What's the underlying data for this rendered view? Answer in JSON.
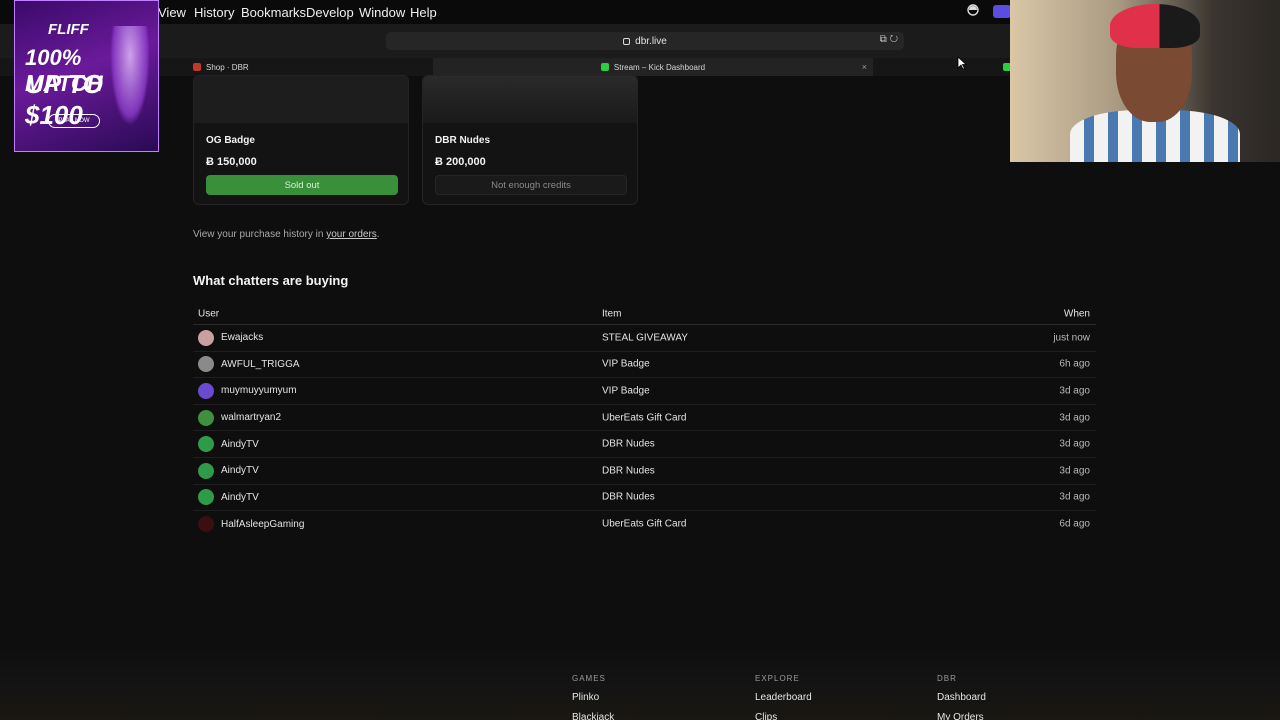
{
  "menubar": {
    "items": [
      "View",
      "History",
      "Bookmarks",
      "Develop",
      "Window",
      "Help"
    ]
  },
  "browser": {
    "url": "dbr.live",
    "tabs": [
      {
        "label": "Shop · DBR"
      },
      {
        "label": "Stream – Kick Dashboard"
      }
    ]
  },
  "ad": {
    "brand": "FLIFF",
    "line1": "100% MATCH",
    "line2": "UP TO $100",
    "cta": "PLAY NOW"
  },
  "shop": {
    "cards": [
      {
        "title": "OG Badge",
        "price": "Ƀ 150,000",
        "button": "Sold out",
        "state": "sold"
      },
      {
        "title": "DBR Nudes",
        "price": "Ƀ 200,000",
        "button": "Not enough credits",
        "state": "disabled"
      }
    ],
    "history_prefix": "View your purchase history in ",
    "history_link": "your orders",
    "history_suffix": "."
  },
  "purchases": {
    "title": "What chatters are buying",
    "headers": {
      "user": "User",
      "item": "Item",
      "when": "When"
    },
    "rows": [
      {
        "user": "Ewajacks",
        "item": "STEAL GIVEAWAY",
        "when": "just now",
        "avatar_color": "#c9a0a0"
      },
      {
        "user": "AWFUL_TRIGGA",
        "item": "VIP Badge",
        "when": "6h ago",
        "avatar_color": "#8a8a8a"
      },
      {
        "user": "muymuyyumyum",
        "item": "VIP Badge",
        "when": "3d ago",
        "avatar_color": "#6a4bd0"
      },
      {
        "user": "walmartryan2",
        "item": "UberEats Gift Card",
        "when": "3d ago",
        "avatar_color": "#3f8f3f"
      },
      {
        "user": "AindyTV",
        "item": "DBR Nudes",
        "when": "3d ago",
        "avatar_color": "#2f9b4a"
      },
      {
        "user": "AindyTV",
        "item": "DBR Nudes",
        "when": "3d ago",
        "avatar_color": "#2f9b4a"
      },
      {
        "user": "AindyTV",
        "item": "DBR Nudes",
        "when": "3d ago",
        "avatar_color": "#2f9b4a"
      },
      {
        "user": "HalfAsleepGaming",
        "item": "UberEats Gift Card",
        "when": "6d ago",
        "avatar_color": "#3a0f12"
      }
    ]
  },
  "footer": {
    "columns": [
      {
        "heading": "GAMES",
        "links": [
          "Plinko",
          "Blackjack"
        ]
      },
      {
        "heading": "EXPLORE",
        "links": [
          "Leaderboard",
          "Clips"
        ]
      },
      {
        "heading": "DBR",
        "links": [
          "Dashboard",
          "My Orders"
        ]
      }
    ]
  }
}
